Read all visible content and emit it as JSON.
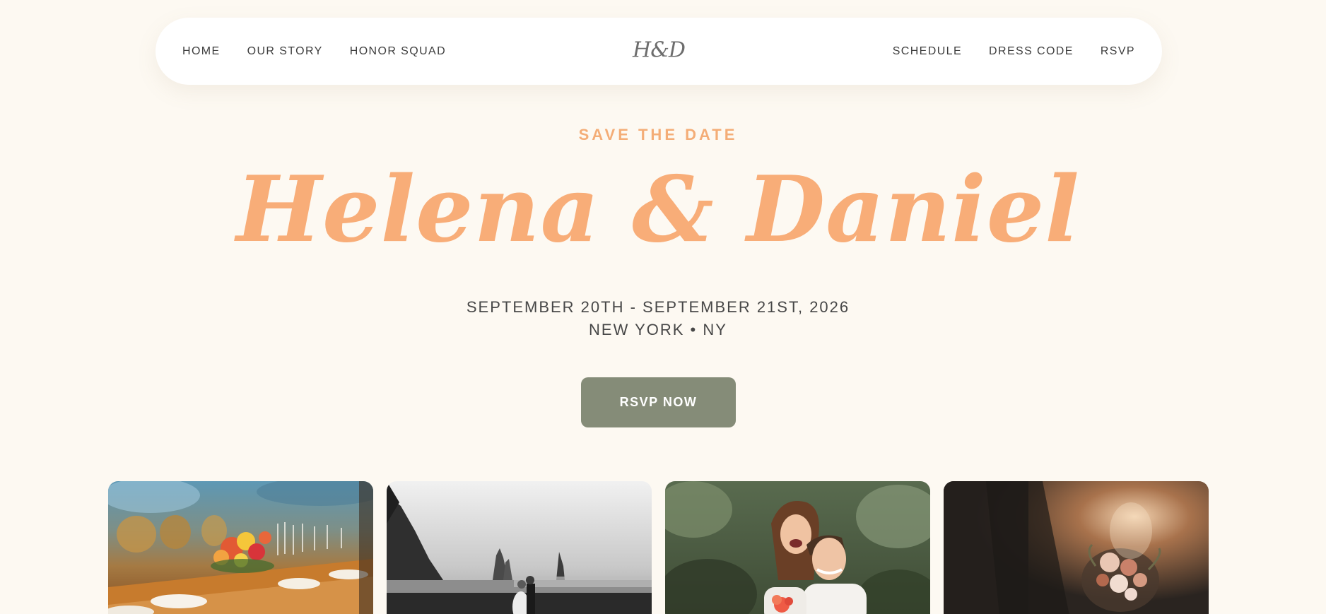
{
  "nav": {
    "left_links": [
      "HOME",
      "OUR STORY",
      "HONOR SQUAD"
    ],
    "brand": "H&D",
    "right_links": [
      "SCHEDULE",
      "DRESS CODE",
      "RSVP"
    ]
  },
  "hero": {
    "eyebrow": "SAVE THE DATE",
    "couple_names": "Helena & Daniel",
    "dates": "SEPTEMBER 20TH - SEPTEMBER 21ST, 2026",
    "location": "NEW YORK • NY",
    "cta_label": "RSVP NOW"
  },
  "gallery": {
    "photos": [
      {
        "subject": "reception-table-photo"
      },
      {
        "subject": "beach-couple-photo"
      },
      {
        "subject": "piggyback-couple-photo"
      },
      {
        "subject": "bouquet-photo"
      }
    ]
  },
  "colors": {
    "background": "#fdf9f2",
    "accent": "#f8ad78",
    "button": "#858c78",
    "text": "#474747"
  }
}
